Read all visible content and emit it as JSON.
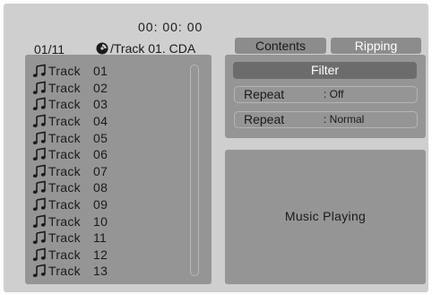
{
  "status": {
    "time": "00: 00: 00",
    "track_count": "01/11",
    "now_playing": "/Track 01. CDA",
    "disc_icon": "disc-icon"
  },
  "tabs": [
    {
      "label": "Contents",
      "active": false
    },
    {
      "label": "Ripping",
      "active": true
    }
  ],
  "tracks": [
    {
      "name": "Track",
      "number": "01"
    },
    {
      "name": "Track",
      "number": "02"
    },
    {
      "name": "Track",
      "number": "03"
    },
    {
      "name": "Track",
      "number": "04"
    },
    {
      "name": "Track",
      "number": "05"
    },
    {
      "name": "Track",
      "number": "06"
    },
    {
      "name": "Track",
      "number": "07"
    },
    {
      "name": "Track",
      "number": "08"
    },
    {
      "name": "Track",
      "number": "09"
    },
    {
      "name": "Track",
      "number": "10"
    },
    {
      "name": "Track",
      "number": "11"
    },
    {
      "name": "Track",
      "number": "12"
    },
    {
      "name": "Track",
      "number": "13"
    }
  ],
  "filter": {
    "button_label": "Filter",
    "options": [
      {
        "label": "Repeat",
        "value": ": Off"
      },
      {
        "label": "Repeat",
        "value": ": Normal"
      }
    ]
  },
  "playback": {
    "status_text": "Music Playing"
  },
  "colors": {
    "background": "#cfcfcf",
    "panel": "#959595",
    "active_button": "#6c6c6c"
  }
}
